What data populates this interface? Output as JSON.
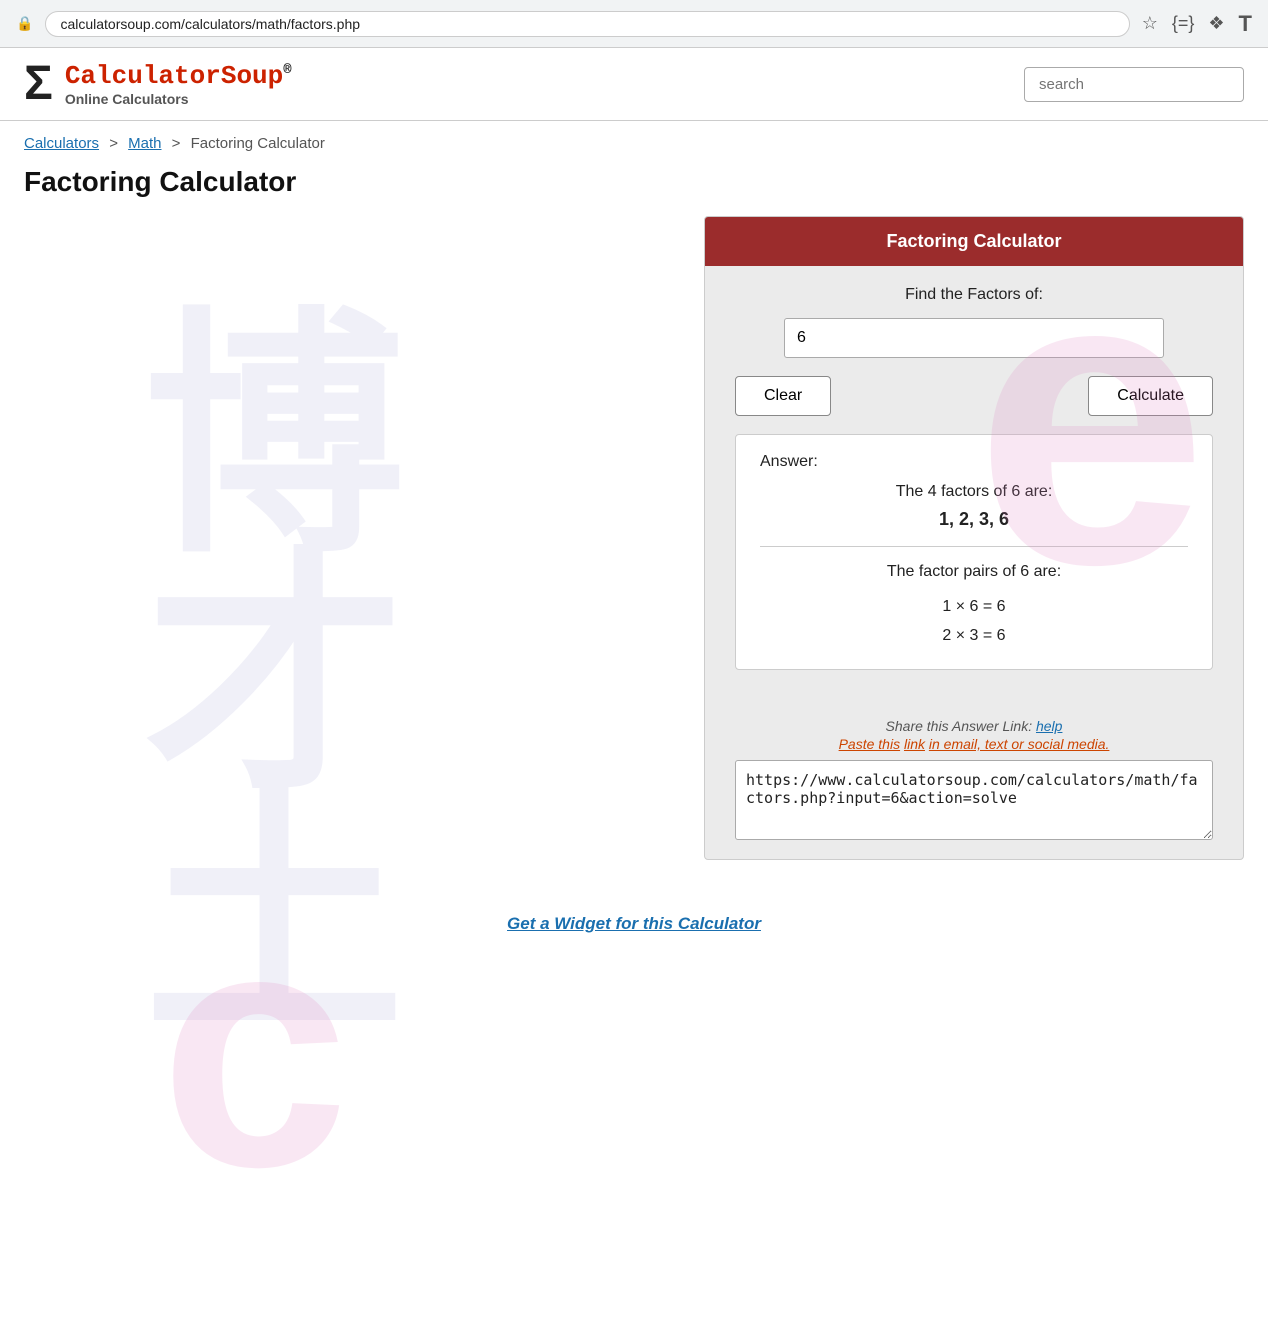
{
  "browser": {
    "url": "calculatorsoup.com/calculators/math/factors.php",
    "search_placeholder": "search"
  },
  "header": {
    "sigma": "Σ",
    "brand_part1": "Calculator",
    "brand_part2": "Soup",
    "registered": "®",
    "tagline": "Online Calculators"
  },
  "breadcrumb": {
    "calculators": "Calculators",
    "sep1": ">",
    "math": "Math",
    "sep2": ">",
    "current": "Factoring Calculator"
  },
  "page_title": "Factoring Calculator",
  "calculator": {
    "title": "Factoring Calculator",
    "find_label": "Find the Factors of:",
    "input_value": "6",
    "clear_label": "Clear",
    "calculate_label": "Calculate",
    "answer_label": "Answer:",
    "result_description": "The 4 factors of 6 are:",
    "result_factors": "1, 2, 3, 6",
    "pairs_label": "The factor pairs of 6 are:",
    "pairs_line1": "1 × 6 = 6",
    "pairs_line2": "2 × 3 = 6"
  },
  "share": {
    "label": "Share this Answer Link:",
    "help_link": "help",
    "note_part1": "Paste this",
    "note_link": "link",
    "note_part2": "in email, text or social media.",
    "url": "https://www.calculatorsoup.com/calculators/math/factors.php?input=6&action=solve"
  },
  "widget": {
    "link_text": "Get a Widget for this Calculator"
  }
}
